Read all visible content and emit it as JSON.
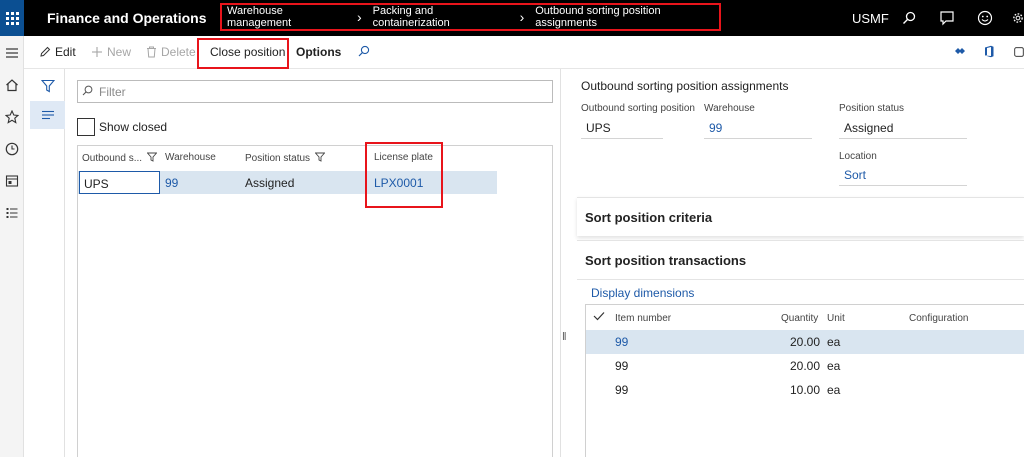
{
  "header": {
    "app_title": "Finance and Operations",
    "breadcrumb": [
      "Warehouse management",
      "Packing and containerization",
      "Outbound sorting position assignments"
    ],
    "company": "USMF",
    "icons": [
      "waffle-icon",
      "search-icon",
      "chat-icon",
      "smiley-icon",
      "gear-icon"
    ]
  },
  "rail": {
    "icons": [
      "hamburger-icon",
      "home-icon",
      "star-icon",
      "clock-icon",
      "workspace-icon",
      "list-icon"
    ]
  },
  "actions": {
    "edit": "Edit",
    "new": "New",
    "delete": "Delete",
    "close_position": "Close position",
    "options": "Options"
  },
  "list": {
    "filter_placeholder": "Filter",
    "show_closed": "Show closed",
    "columns": [
      "Outbound s...",
      "Warehouse",
      "Position status",
      "License plate"
    ],
    "rows": [
      {
        "position": "UPS",
        "warehouse": "99",
        "status": "Assigned",
        "license_plate": "LPX0001"
      }
    ]
  },
  "details": {
    "title": "Outbound sorting position assignments",
    "fields": {
      "position_label": "Outbound sorting position",
      "position_value": "UPS",
      "warehouse_label": "Warehouse",
      "warehouse_value": "99",
      "status_label": "Position status",
      "status_value": "Assigned",
      "location_label": "Location",
      "location_value": "Sort"
    },
    "fasttab_criteria": "Sort position criteria",
    "fasttab_transactions": "Sort position transactions",
    "display_dimensions": "Display dimensions",
    "line_columns": {
      "item": "Item number",
      "quantity": "Quantity",
      "unit": "Unit",
      "configuration": "Configuration"
    },
    "lines": [
      {
        "item": "99",
        "quantity": "20.00",
        "unit": "ea"
      },
      {
        "item": "99",
        "quantity": "20.00",
        "unit": "ea"
      },
      {
        "item": "99",
        "quantity": "10.00",
        "unit": "ea"
      }
    ]
  },
  "colors": {
    "highlight_border": "#e8141b",
    "link": "#1e5aa8",
    "selected_row": "#d9e5f0",
    "waffle_bg": "#0b4f92"
  }
}
